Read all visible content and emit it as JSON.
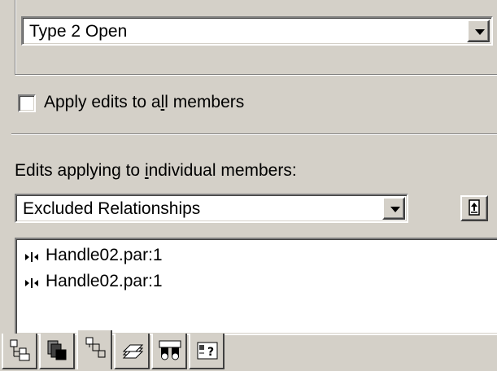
{
  "type_combo": {
    "value": "Type 2 Open"
  },
  "apply_all": {
    "label_pre": "Apply edits to a",
    "label_ul": "l",
    "label_post": "l members",
    "checked": false
  },
  "individual": {
    "label_pre": "Edits applying to ",
    "label_ul": "i",
    "label_post": "ndividual members:",
    "combo_value": "Excluded Relationships"
  },
  "relationships": {
    "items": [
      {
        "label": "Handle02.par:1"
      },
      {
        "label": "Handle02.par:1"
      }
    ]
  },
  "tabs": [
    {
      "icon": "tree-icon"
    },
    {
      "icon": "parts-stack-icon"
    },
    {
      "icon": "hierarchy-icon"
    },
    {
      "icon": "layers-icon"
    },
    {
      "icon": "binoculars-icon"
    },
    {
      "icon": "properties-icon"
    }
  ],
  "colors": {
    "background": "#d4d0c8",
    "field": "#ffffff",
    "shadow": "#808080",
    "highlight": "#ffffff"
  }
}
